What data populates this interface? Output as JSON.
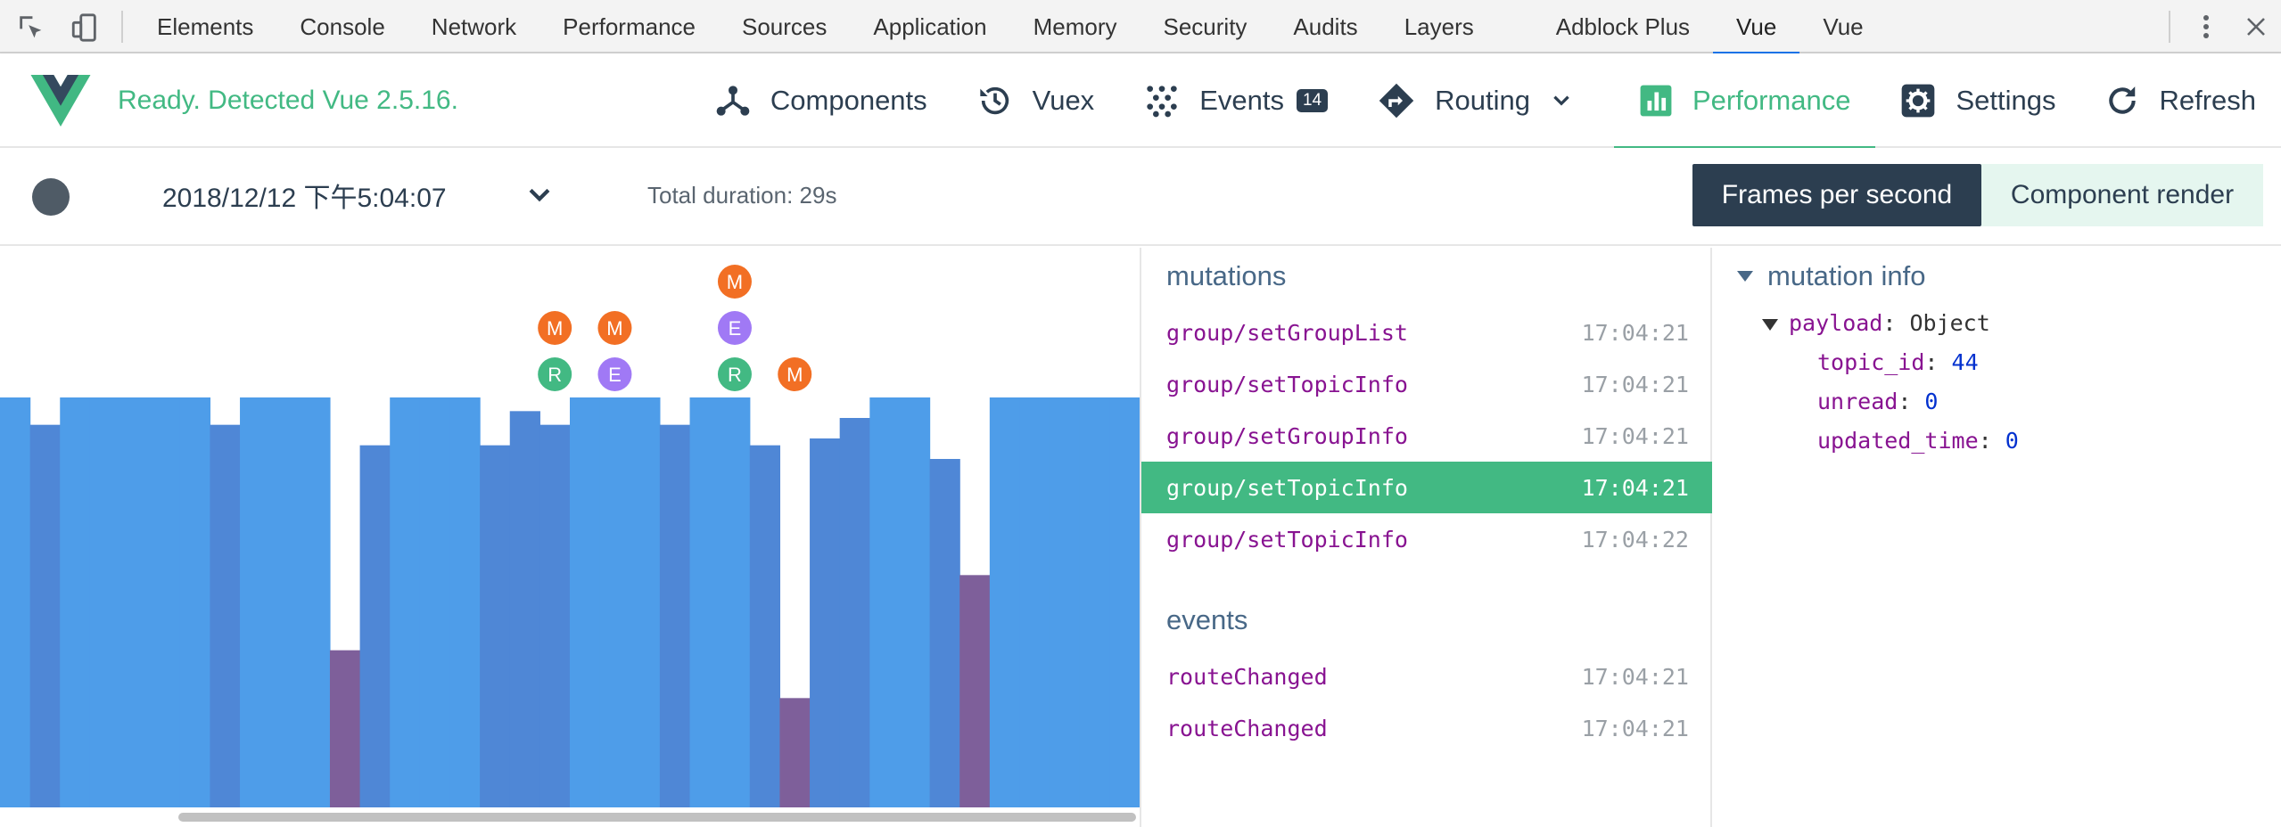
{
  "devtools": {
    "tabs": [
      "Elements",
      "Console",
      "Network",
      "Performance",
      "Sources",
      "Application",
      "Memory",
      "Security",
      "Audits",
      "Layers",
      "Adblock Plus",
      "Vue",
      "Vue"
    ],
    "active_tab_index": 11,
    "icons": [
      "inspect-element-icon",
      "device-toolbar-icon",
      "more-vertical-icon",
      "close-icon"
    ]
  },
  "header": {
    "status": "Ready. Detected Vue 2.5.16.",
    "nav": [
      {
        "label": "Components",
        "icon": "components-icon"
      },
      {
        "label": "Vuex",
        "icon": "history-icon"
      },
      {
        "label": "Events",
        "icon": "events-icon",
        "badge": "14"
      },
      {
        "label": "Routing",
        "icon": "routing-icon",
        "dropdown": true
      },
      {
        "label": "Performance",
        "icon": "bar-chart-icon",
        "active": true
      },
      {
        "label": "Settings",
        "icon": "settings-icon"
      },
      {
        "label": "Refresh",
        "icon": "refresh-icon"
      }
    ]
  },
  "toolbar": {
    "recording_date": "2018/12/12 下午5:04:07",
    "total_duration": "Total duration: 29s",
    "fps_button": "Frames per second",
    "component_render_button": "Component render"
  },
  "colors": {
    "vue_green": "#42b983",
    "navy": "#2c3e50",
    "fps_high": "#4e9de9",
    "fps_mid": "#4f87d6",
    "fps_low": "#7e5f9a",
    "marker_mutation": "#f26f24",
    "marker_event": "#a079f5",
    "marker_route": "#42b983"
  },
  "chart_data": {
    "type": "bar",
    "series": [
      {
        "name": "fps",
        "values": [
          60,
          56,
          60,
          60,
          60,
          60,
          60,
          56,
          60,
          60,
          60,
          23,
          53,
          60,
          60,
          60,
          53,
          58,
          56,
          60,
          60,
          60,
          56,
          60,
          60,
          53,
          16,
          54,
          57,
          60,
          60,
          51,
          34,
          60,
          60,
          60,
          60,
          60
        ]
      },
      {
        "name": "markers",
        "values": [
          {
            "bar": 18,
            "labels": [
              "M",
              "R"
            ]
          },
          {
            "bar": 20,
            "labels": [
              "M",
              "E"
            ]
          },
          {
            "bar": 24,
            "labels": [
              "M",
              "E",
              "R"
            ]
          },
          {
            "bar": 26,
            "labels": [
              "M"
            ]
          }
        ]
      }
    ],
    "ylim": [
      0,
      60
    ]
  },
  "mutations": {
    "title": "mutations",
    "items": [
      {
        "name": "group/setGroupList",
        "time": "17:04:21"
      },
      {
        "name": "group/setTopicInfo",
        "time": "17:04:21"
      },
      {
        "name": "group/setGroupInfo",
        "time": "17:04:21"
      },
      {
        "name": "group/setTopicInfo",
        "time": "17:04:21",
        "selected": true
      },
      {
        "name": "group/setTopicInfo",
        "time": "17:04:22"
      }
    ]
  },
  "events": {
    "title": "events",
    "items": [
      {
        "name": "routeChanged",
        "time": "17:04:21"
      },
      {
        "name": "routeChanged",
        "time": "17:04:21"
      }
    ]
  },
  "info": {
    "title": "mutation info",
    "payload_key": "payload",
    "payload_type": "Object",
    "fields": [
      {
        "key": "topic_id",
        "value": "44"
      },
      {
        "key": "unread",
        "value": "0"
      },
      {
        "key": "updated_time",
        "value": "0"
      }
    ]
  }
}
